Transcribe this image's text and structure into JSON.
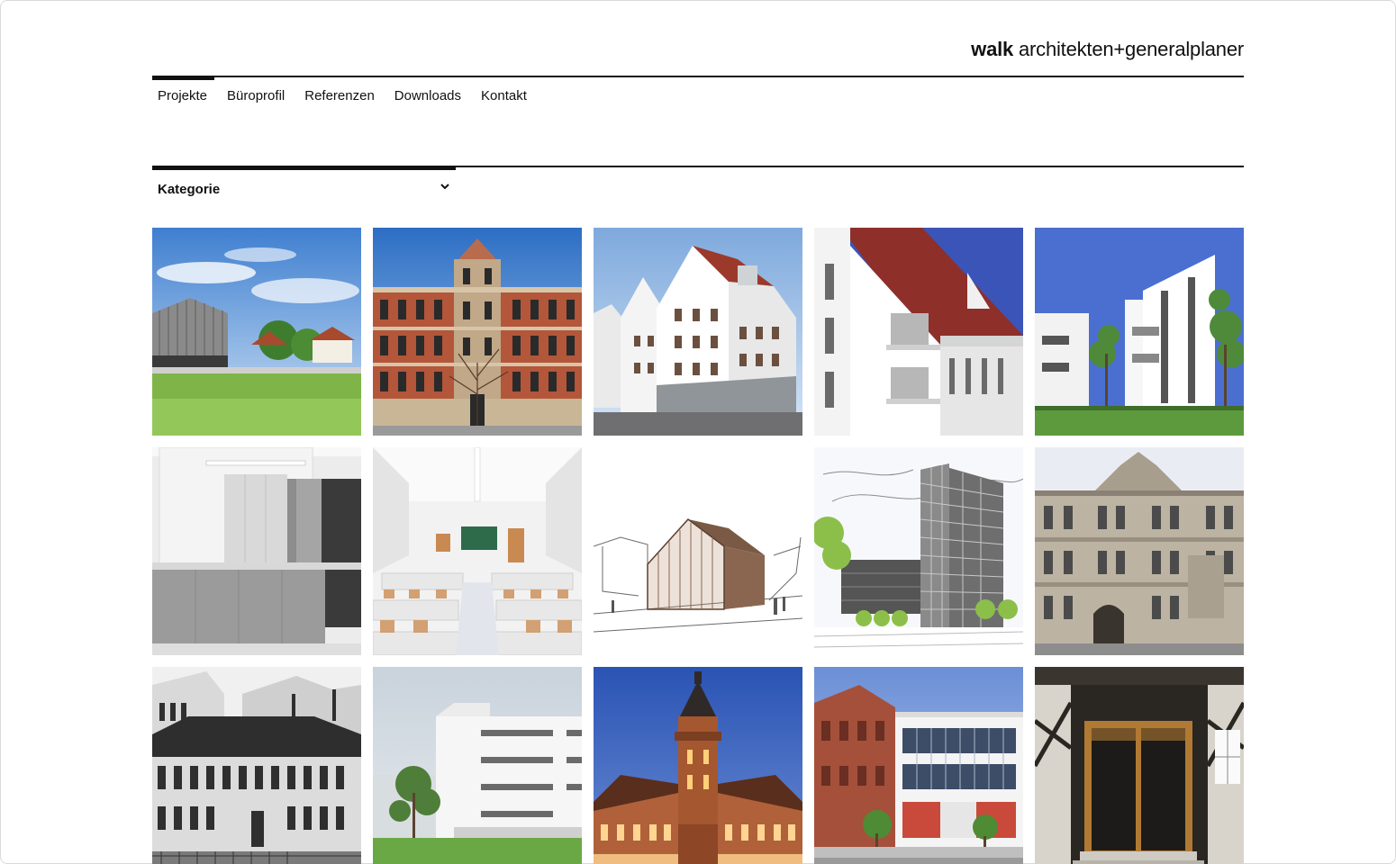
{
  "logo": {
    "brand": "walk",
    "rest": "architekten+generalplaner"
  },
  "nav": {
    "items": [
      {
        "label": "Projekte",
        "active": true
      },
      {
        "label": "Büroprofil"
      },
      {
        "label": "Referenzen"
      },
      {
        "label": "Downloads"
      },
      {
        "label": "Kontakt"
      }
    ]
  },
  "filter": {
    "label": "Kategorie",
    "icon": "chevron-down-icon"
  },
  "projects": {
    "count": 15,
    "tiles": [
      {
        "name": "project-tile-wooden-barn-hall",
        "kind": "photo"
      },
      {
        "name": "project-tile-historic-brick-school",
        "kind": "photo"
      },
      {
        "name": "project-tile-white-gabled-houses",
        "kind": "photo"
      },
      {
        "name": "project-tile-red-roof-apartments",
        "kind": "photo"
      },
      {
        "name": "project-tile-white-modern-apartments",
        "kind": "photo"
      },
      {
        "name": "project-tile-kitchen-interior",
        "kind": "photo"
      },
      {
        "name": "project-tile-classroom-interior",
        "kind": "photo"
      },
      {
        "name": "project-tile-gabled-sketch",
        "kind": "sketch"
      },
      {
        "name": "project-tile-tower-sketch",
        "kind": "sketch"
      },
      {
        "name": "project-tile-sandstone-facade",
        "kind": "photo"
      },
      {
        "name": "project-tile-historic-bw-photo",
        "kind": "photo"
      },
      {
        "name": "project-tile-white-block-building",
        "kind": "photo"
      },
      {
        "name": "project-tile-illuminated-tower-hall",
        "kind": "photo"
      },
      {
        "name": "project-tile-glass-corner-building",
        "kind": "photo"
      },
      {
        "name": "project-tile-timber-frame-door",
        "kind": "photo"
      }
    ]
  }
}
